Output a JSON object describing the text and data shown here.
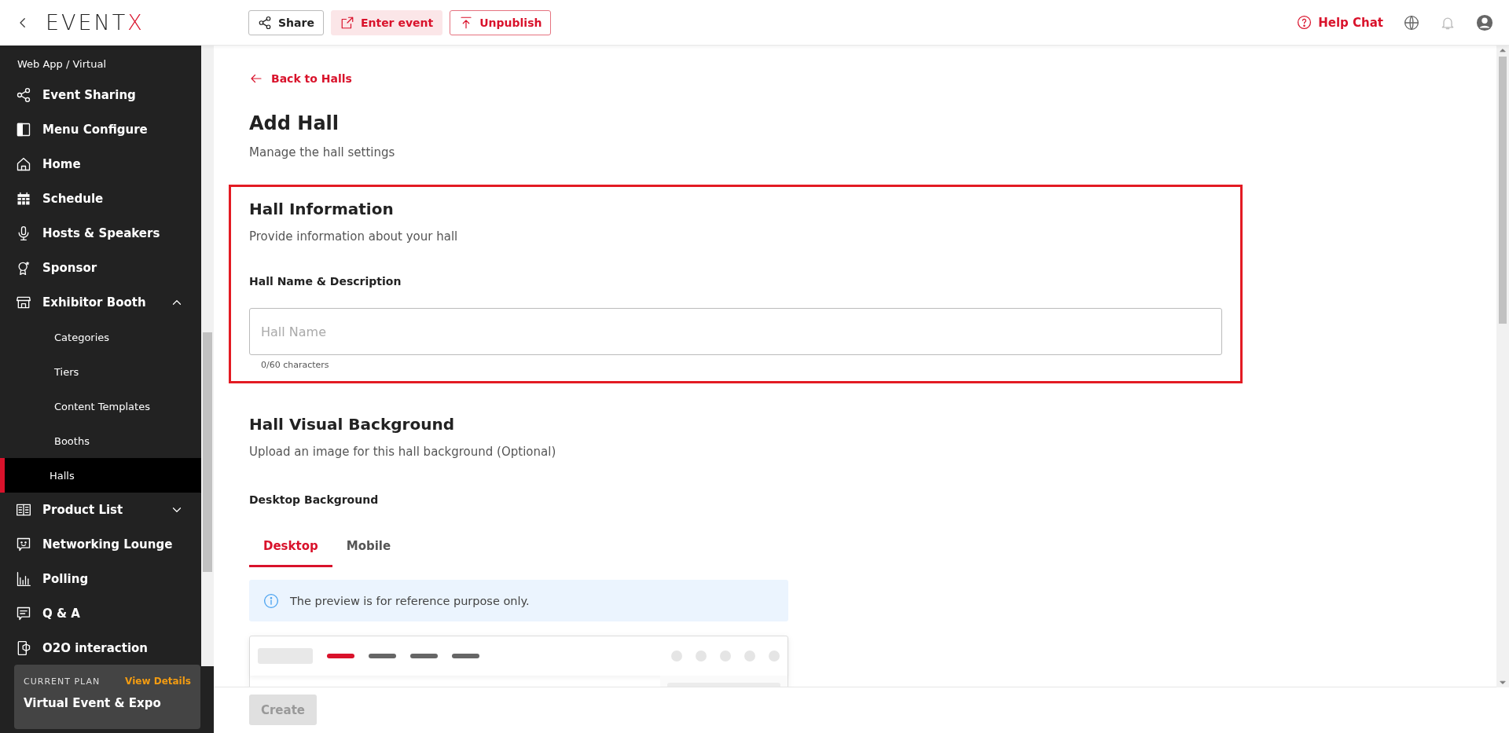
{
  "topbar": {
    "logo": "EVENTX",
    "buttons": [
      {
        "kind": "share",
        "label": "Share"
      },
      {
        "kind": "enter",
        "label": "Enter event"
      },
      {
        "kind": "unpublish",
        "label": "Unpublish"
      }
    ],
    "help": "Help Chat"
  },
  "sidebar": {
    "breadcrumb": "Web App / Virtual",
    "items": [
      {
        "kind": "share",
        "label": "Event Sharing"
      },
      {
        "kind": "panel",
        "label": "Menu Configure"
      },
      {
        "kind": "home",
        "label": "Home"
      },
      {
        "kind": "calendar",
        "label": "Schedule"
      },
      {
        "kind": "mic",
        "label": "Hosts & Speakers"
      },
      {
        "kind": "award",
        "label": "Sponsor"
      },
      {
        "kind": "store",
        "label": "Exhibitor Booth",
        "expanded": true,
        "children": [
          {
            "label": "Categories",
            "selected": false
          },
          {
            "label": "Tiers",
            "selected": false
          },
          {
            "label": "Content Templates",
            "selected": false
          },
          {
            "label": "Booths",
            "selected": false
          },
          {
            "label": "Halls",
            "selected": true
          }
        ]
      },
      {
        "kind": "book",
        "label": "Product List",
        "expanded": false
      },
      {
        "kind": "chatsmile",
        "label": "Networking Lounge"
      },
      {
        "kind": "bars",
        "label": "Polling"
      },
      {
        "kind": "chat",
        "label": "Q & A"
      },
      {
        "kind": "phone",
        "label": "O2O interaction"
      }
    ],
    "plan": {
      "caption": "CURRENT PLAN",
      "link": "View Details",
      "name": "Virtual Event & Expo"
    }
  },
  "main": {
    "back": "Back to Halls",
    "title": "Add Hall",
    "subtitle": "Manage the hall settings",
    "hall_information": {
      "title": "Hall Information",
      "subtitle": "Provide information about your hall",
      "field_label": "Hall Name & Description",
      "placeholder": "Hall Name",
      "counter": "0/60 characters"
    },
    "visual_background": {
      "title": "Hall Visual Background",
      "subtitle": "Upload an image for this hall background (Optional)",
      "label": "Desktop Background",
      "tabs": [
        {
          "label": "Desktop",
          "selected": true
        },
        {
          "label": "Mobile",
          "selected": false
        }
      ],
      "notice": "The preview is for reference purpose only."
    },
    "create": "Create"
  }
}
